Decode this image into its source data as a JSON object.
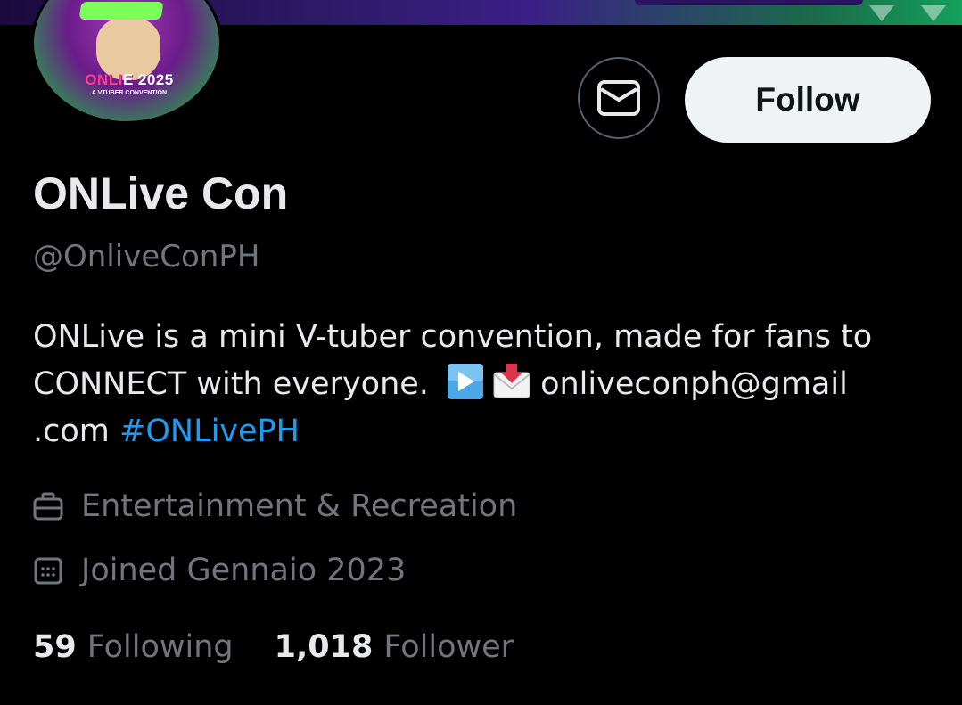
{
  "profile": {
    "display_name": "ONLive Con",
    "handle": "@OnliveConPH",
    "avatar_logo_left": "ONL",
    "avatar_logo_mid": "I",
    "avatar_logo_right": "E 2025",
    "avatar_logo_sub": "A VTUBER CONVENTION"
  },
  "actions": {
    "message_icon": "envelope-icon",
    "follow_label": "Follow"
  },
  "bio": {
    "line1": "ONLive is a mini V-tuber convention, made for fans to",
    "line2_text": "CONNECT with everyone.",
    "play_emoji": "▶️",
    "inbox_emoji": "📩",
    "line2_email": "onliveconph@gmail",
    "line3_text": ".com",
    "hashtag": "#ONLivePH"
  },
  "meta": {
    "category_icon": "briefcase-icon",
    "category": "Entertainment & Recreation",
    "joined_icon": "calendar-icon",
    "joined": "Joined Gennaio 2023"
  },
  "stats": {
    "following_count": "59",
    "following_label": "Following",
    "followers_count": "1,018",
    "followers_label": "Follower"
  },
  "colors": {
    "background": "#000000",
    "text_primary": "#e7e9ea",
    "text_secondary": "#71767b",
    "link": "#1d9bf0",
    "follow_button_bg": "#eff3f4"
  }
}
